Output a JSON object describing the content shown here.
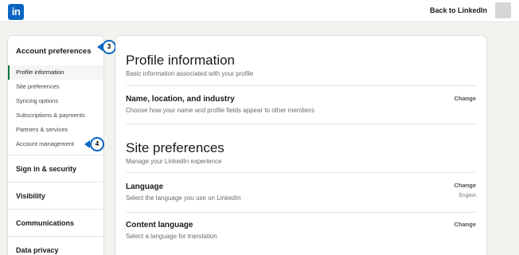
{
  "header": {
    "logo_text": "in",
    "back_link": "Back to LinkedIn"
  },
  "sidebar": {
    "section_title": "Account preferences",
    "items": [
      {
        "label": "Profile information"
      },
      {
        "label": "Site preferences"
      },
      {
        "label": "Syncing options"
      },
      {
        "label": "Subscriptions & payments"
      },
      {
        "label": "Partners & services"
      },
      {
        "label": "Account management"
      }
    ],
    "groups": [
      {
        "label": "Sign in & security"
      },
      {
        "label": "Visibility"
      },
      {
        "label": "Communications"
      },
      {
        "label": "Data privacy"
      }
    ]
  },
  "callouts": {
    "first": "3",
    "second": "4"
  },
  "main": {
    "profile": {
      "title": "Profile information",
      "subtitle": "Basic information associated with your profile",
      "rows": [
        {
          "title": "Name, location, and industry",
          "desc": "Choose how your name and profile fields appear to other members",
          "action": "Change"
        }
      ]
    },
    "site": {
      "title": "Site preferences",
      "subtitle": "Manage your LinkedIn experience",
      "rows": [
        {
          "title": "Language",
          "desc": "Select the language you use on LinkedIn",
          "action": "Change",
          "value": "English"
        },
        {
          "title": "Content language",
          "desc": "Select a language for translation",
          "action": "Change"
        }
      ]
    }
  },
  "colors": {
    "brand": "#0a66c2",
    "active_indicator": "#057642",
    "page_bg": "#f3f2ef"
  }
}
